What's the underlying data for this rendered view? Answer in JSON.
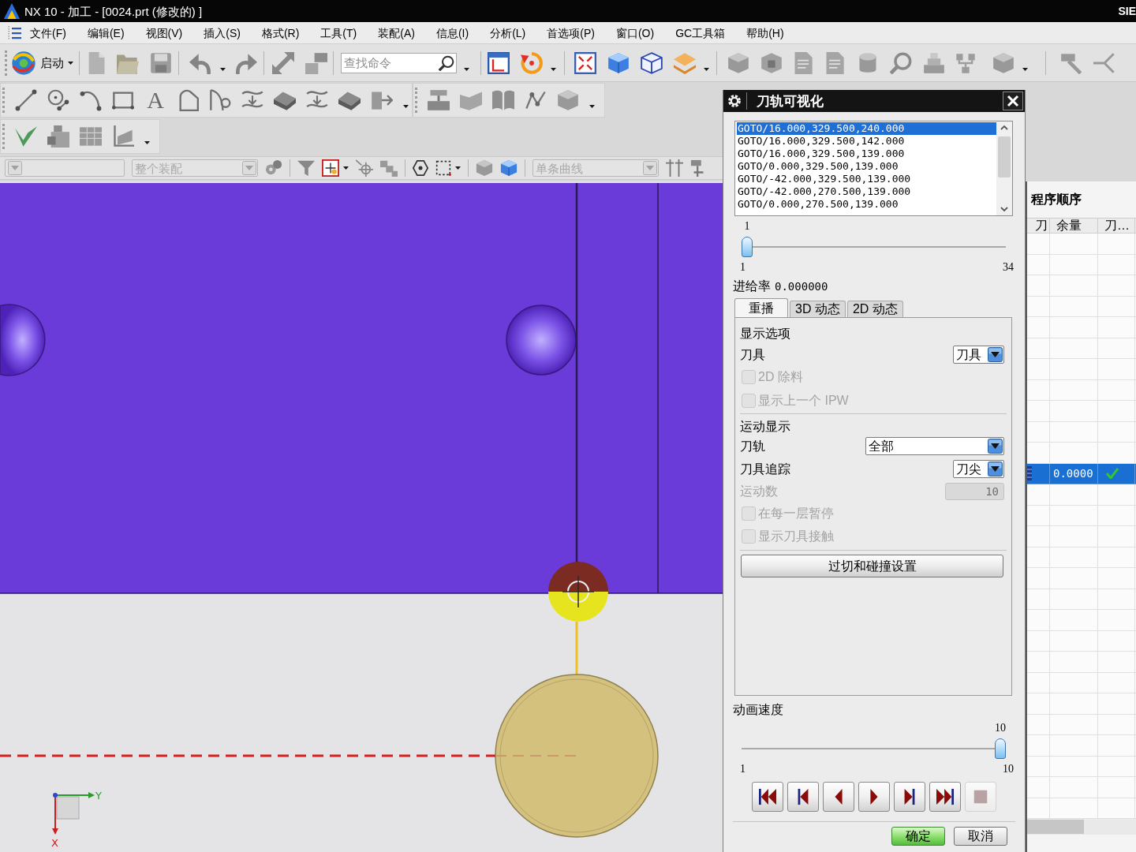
{
  "window": {
    "title": "NX 10 - 加工 - [0024.prt (修改的) ]",
    "brand": "SIE"
  },
  "menu": [
    "文件(F)",
    "编辑(E)",
    "视图(V)",
    "插入(S)",
    "格式(R)",
    "工具(T)",
    "装配(A)",
    "信息(I)",
    "分析(L)",
    "首选项(P)",
    "窗口(O)",
    "GC工具箱",
    "帮助(H)"
  ],
  "toolbar": {
    "start_label": "启动",
    "search": {
      "placeholder": "查找命令"
    },
    "text_tool": "A"
  },
  "selection_bar": {
    "scope": "整个装配",
    "curve_rule": "单条曲线"
  },
  "viewport": {
    "axis_x": "X",
    "axis_y": "Y"
  },
  "dialog": {
    "title": "刀轨可视化",
    "moves": [
      {
        "text": "GOTO/16.000,329.500,240.000",
        "selected": true
      },
      {
        "text": "GOTO/16.000,329.500,142.000",
        "selected": false
      },
      {
        "text": "GOTO/16.000,329.500,139.000",
        "selected": false
      },
      {
        "text": "GOTO/0.000,329.500,139.000",
        "selected": false
      },
      {
        "text": "GOTO/-42.000,329.500,139.000",
        "selected": false
      },
      {
        "text": "GOTO/-42.000,270.500,139.000",
        "selected": false
      },
      {
        "text": "GOTO/0.000,270.500,139.000",
        "selected": false
      }
    ],
    "step_slider": {
      "value": "1",
      "min": "1",
      "max": "34",
      "level": 0
    },
    "feed_rate": {
      "label": "进给率",
      "value": "0.000000"
    },
    "tabs": [
      {
        "label": "重播",
        "selected": true
      },
      {
        "label": "3D 动态",
        "selected": false
      },
      {
        "label": "2D 动态",
        "selected": false
      }
    ],
    "display_options": {
      "title": "显示选项",
      "tool": {
        "label": "刀具",
        "value": "刀具"
      },
      "checkboxes": [
        {
          "label": "2D 除料",
          "checked": false,
          "disabled": true
        },
        {
          "label": "显示上一个 IPW",
          "checked": false,
          "disabled": true
        }
      ]
    },
    "motion_display": {
      "title": "运动显示",
      "toolpath": {
        "label": "刀轨",
        "value": "全部"
      },
      "tool_trace": {
        "label": "刀具追踪",
        "value": "刀尖"
      },
      "motion_count": {
        "label": "运动数",
        "value": "10",
        "disabled": true
      },
      "checkboxes": [
        {
          "label": "在每一层暂停",
          "checked": false,
          "disabled": true
        },
        {
          "label": "显示刀具接触",
          "checked": false,
          "disabled": true
        }
      ]
    },
    "gouge_button": "过切和碰撞设置",
    "speed": {
      "label": "动画速度",
      "value": "10",
      "min": "1",
      "max": "10",
      "level": 1
    },
    "playback": [
      {
        "kind": "to_start",
        "disabled": false
      },
      {
        "kind": "step_back",
        "disabled": false
      },
      {
        "kind": "reverse",
        "disabled": false
      },
      {
        "kind": "play",
        "disabled": false
      },
      {
        "kind": "step_forward",
        "disabled": false
      },
      {
        "kind": "to_end",
        "disabled": false
      },
      {
        "kind": "stop",
        "disabled": true
      }
    ],
    "buttons": [
      {
        "label": "确定",
        "kind": "primary"
      },
      {
        "label": "取消",
        "kind": "secondary"
      }
    ]
  },
  "navigator": {
    "title": "程序顺序",
    "columns": [
      "刀",
      "余量",
      "刀…"
    ],
    "rows": [
      {
        "selected": false,
        "verified": false
      },
      {
        "selected": false,
        "verified": false
      },
      {
        "selected": false,
        "verified": false
      },
      {
        "selected": false,
        "verified": false
      },
      {
        "selected": false,
        "verified": false
      },
      {
        "selected": false,
        "verified": false
      },
      {
        "selected": false,
        "verified": false
      },
      {
        "selected": false,
        "verified": false
      },
      {
        "selected": false,
        "verified": false
      },
      {
        "selected": false,
        "verified": false
      },
      {
        "selected": false,
        "verified": false
      },
      {
        "selected": true,
        "verified": true,
        "stock": "0.0000"
      },
      {
        "selected": false,
        "verified": false
      },
      {
        "selected": false,
        "verified": false
      },
      {
        "selected": false,
        "verified": false
      },
      {
        "selected": false,
        "verified": false
      },
      {
        "selected": false,
        "verified": false
      },
      {
        "selected": false,
        "verified": false
      },
      {
        "selected": false,
        "verified": false
      },
      {
        "selected": false,
        "verified": false
      },
      {
        "selected": false,
        "verified": false
      },
      {
        "selected": false,
        "verified": false
      },
      {
        "selected": false,
        "verified": false
      },
      {
        "selected": false,
        "verified": false
      },
      {
        "selected": false,
        "verified": false
      },
      {
        "selected": false,
        "verified": false
      },
      {
        "selected": false,
        "verified": false
      },
      {
        "selected": false,
        "verified": false
      }
    ]
  }
}
